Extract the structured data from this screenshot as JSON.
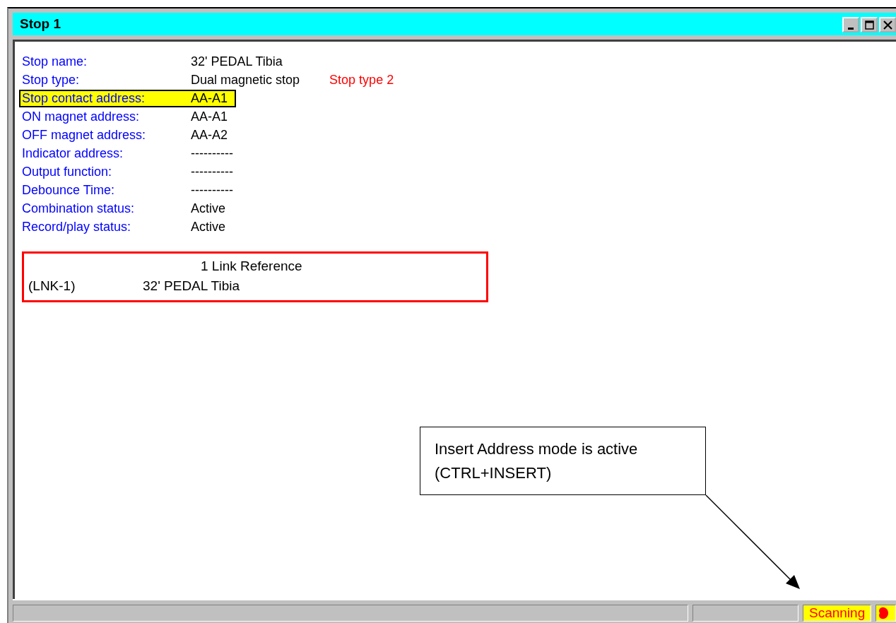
{
  "window": {
    "title": "Stop 1"
  },
  "properties": [
    {
      "label": "Stop name:",
      "value": "32' PEDAL Tibia",
      "highlighted": false
    },
    {
      "label": "Stop type:",
      "value": "Dual magnetic stop",
      "note": "Stop type 2",
      "highlighted": false
    },
    {
      "label": "Stop contact address:",
      "value": "AA-A1",
      "highlighted": true
    },
    {
      "label": "ON magnet address:",
      "value": "AA-A1",
      "highlighted": false
    },
    {
      "label": "OFF magnet address:",
      "value": "AA-A2",
      "highlighted": false
    },
    {
      "label": "Indicator address:",
      "value": "----------",
      "highlighted": false
    },
    {
      "label": "Output function:",
      "value": "----------",
      "highlighted": false
    },
    {
      "label": "Debounce Time:",
      "value": "----------",
      "highlighted": false
    },
    {
      "label": "Combination status:",
      "value": "Active",
      "highlighted": false
    },
    {
      "label": "Record/play status:",
      "value": "Active",
      "highlighted": false
    }
  ],
  "link_references": {
    "heading": "1 Link Reference",
    "items": [
      {
        "id": "(LNK-1)",
        "name": "32' PEDAL Tibia"
      }
    ]
  },
  "callout": {
    "lines": [
      "Insert Address mode is active",
      "(CTRL+INSERT)"
    ]
  },
  "status_bar": {
    "panes": [
      {
        "kind": "empty"
      },
      {
        "kind": "empty"
      },
      {
        "kind": "status",
        "text": "Scanning"
      },
      {
        "kind": "indicator"
      }
    ]
  }
}
